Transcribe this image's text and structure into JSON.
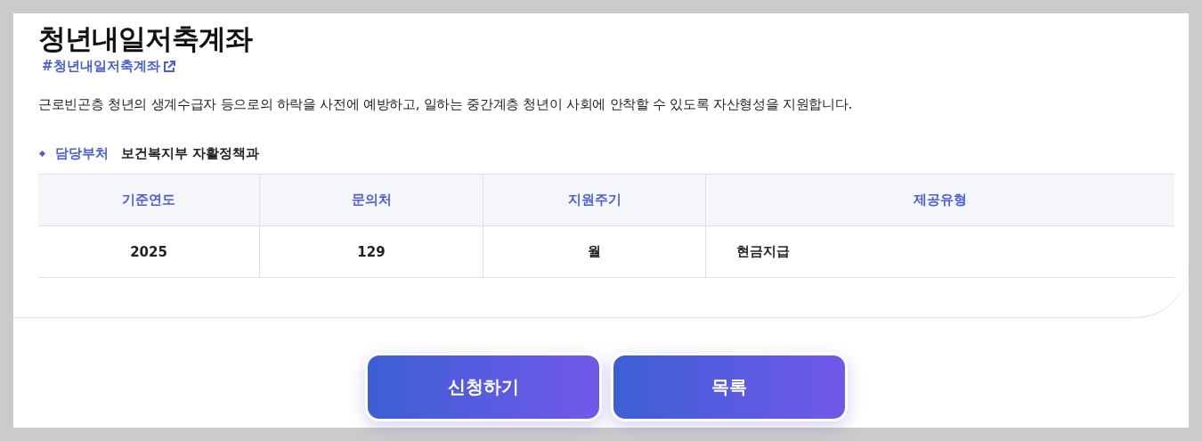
{
  "title": "청년내일저축계좌",
  "hashtag": "#청년내일저축계좌",
  "description": "근로빈곤층 청년의 생계수급자 등으로의 하락을 사전에 예방하고, 일하는 중간계층 청년이 사회에 안착할 수 있도록 자산형성을 지원합니다.",
  "department": {
    "label": "담당부처",
    "value": "보건복지부 자활정책과"
  },
  "table": {
    "columns": [
      "기준연도",
      "문의처",
      "지원주기",
      "제공유형"
    ],
    "rows": [
      [
        "2025",
        "129",
        "월",
        "현금지급"
      ]
    ]
  },
  "buttons": [
    "신청하기",
    "목록"
  ]
}
